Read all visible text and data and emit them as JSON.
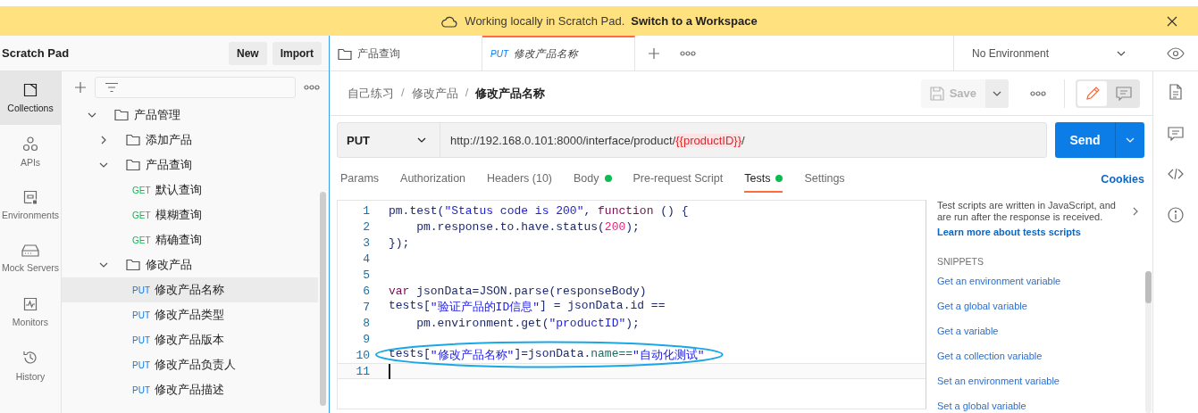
{
  "banner": {
    "text": "Working locally in Scratch Pad.",
    "link": "Switch to a Workspace"
  },
  "sidebar": {
    "title": "Scratch Pad",
    "buttons": [
      "New",
      "Import"
    ],
    "rail": [
      {
        "kind": "collections",
        "label": "Collections",
        "selected": true
      },
      {
        "kind": "apis",
        "label": "APIs",
        "selected": false
      },
      {
        "kind": "environments",
        "label": "Environments",
        "selected": false
      },
      {
        "kind": "mock",
        "label": "Mock Servers",
        "selected": false
      },
      {
        "kind": "monitors",
        "label": "Monitors",
        "selected": false
      },
      {
        "kind": "history",
        "label": "History",
        "selected": false
      }
    ],
    "tree": [
      {
        "kind": "folder",
        "name": "产品管理",
        "expanded": true,
        "children": [
          {
            "kind": "folder",
            "name": "添加产品",
            "expanded": false
          },
          {
            "kind": "folder",
            "name": "产品查询",
            "expanded": true,
            "children": [
              {
                "kind": "request",
                "method": "GET",
                "name": "默认查询",
                "selected": false
              },
              {
                "kind": "request",
                "method": "GET",
                "name": "模糊查询",
                "selected": false
              },
              {
                "kind": "request",
                "method": "GET",
                "name": "精确查询",
                "selected": false
              }
            ]
          },
          {
            "kind": "folder",
            "name": "修改产品",
            "expanded": true,
            "children": [
              {
                "kind": "request",
                "method": "PUT",
                "name": "修改产品名称",
                "selected": true
              },
              {
                "kind": "request",
                "method": "PUT",
                "name": "修改产品类型",
                "selected": false
              },
              {
                "kind": "request",
                "method": "PUT",
                "name": "修改产品版本",
                "selected": false
              },
              {
                "kind": "request",
                "method": "PUT",
                "name": "修改产品负责人",
                "selected": false
              },
              {
                "kind": "request",
                "method": "PUT",
                "name": "修改产品描述",
                "selected": false
              }
            ]
          }
        ]
      }
    ]
  },
  "tabs": [
    {
      "kind": "folder",
      "label": "产品查询",
      "preview": false,
      "selected": false
    },
    {
      "kind": "request",
      "method": "PUT",
      "label": "修改产品名称",
      "preview": true,
      "selected": true
    }
  ],
  "environment": "No Environment",
  "breadcrumb": [
    "自己练习",
    "修改产品",
    "修改产品名称"
  ],
  "breadcrumb_separator": "/",
  "save": {
    "label": "Save",
    "disabled": true
  },
  "mode_toggle": [
    {
      "kind": "edit",
      "selected": true
    },
    {
      "kind": "comment",
      "selected": false
    }
  ],
  "request": {
    "method": "PUT",
    "url": [
      {
        "kind": "text",
        "text": "http://192.168.0.101:8000/interface/product/"
      },
      {
        "kind": "variable",
        "text": "{{productID}}"
      },
      {
        "kind": "text",
        "text": "/"
      }
    ],
    "send": "Send"
  },
  "request_tabs": [
    {
      "label": "Params",
      "dot": false,
      "selected": false
    },
    {
      "label": "Authorization",
      "dot": false,
      "selected": false
    },
    {
      "label": "Headers (10)",
      "dot": false,
      "selected": false
    },
    {
      "label": "Body",
      "dot": true,
      "selected": false
    },
    {
      "label": "Pre-request Script",
      "dot": false,
      "selected": false
    },
    {
      "label": "Tests",
      "dot": true,
      "selected": true
    },
    {
      "label": "Settings",
      "dot": false,
      "selected": false
    }
  ],
  "cookies": "Cookies",
  "editor": {
    "lines": [
      {
        "number": "1",
        "tokens": [
          {
            "kind": "plain",
            "text": "pm.test("
          },
          {
            "kind": "string",
            "text": "\"Status code is 200\""
          },
          {
            "kind": "plain",
            "text": ", "
          },
          {
            "kind": "keyword",
            "text": "function"
          },
          {
            "kind": "plain",
            "text": " () {"
          }
        ],
        "circled": false,
        "active": false
      },
      {
        "number": "2",
        "tokens": [
          {
            "kind": "plain",
            "text": "    pm.response.to.have.status("
          },
          {
            "kind": "number",
            "text": "200"
          },
          {
            "kind": "plain",
            "text": ");"
          }
        ],
        "circled": false,
        "active": false
      },
      {
        "number": "3",
        "tokens": [
          {
            "kind": "plain",
            "text": "});"
          }
        ],
        "circled": false,
        "active": false
      },
      {
        "number": "4",
        "circled": false,
        "active": false
      },
      {
        "number": "5",
        "circled": false,
        "active": false
      },
      {
        "number": "6",
        "tokens": [
          {
            "kind": "keyword",
            "text": "var"
          },
          {
            "kind": "plain",
            "text": " jsonData=JSON.parse(responseBody)"
          }
        ],
        "circled": false,
        "active": false
      },
      {
        "number": "7",
        "tokens": [
          {
            "kind": "plain",
            "text": "tests["
          },
          {
            "kind": "string",
            "text": "\"验证产品的ID信息\""
          },
          {
            "kind": "plain",
            "text": "] = jsonData.id =="
          }
        ],
        "circled": false,
        "active": false
      },
      {
        "number": "8",
        "tokens": [
          {
            "kind": "plain",
            "text": "    pm.environment.get("
          },
          {
            "kind": "string",
            "text": "\"productID\""
          },
          {
            "kind": "plain",
            "text": ");"
          }
        ],
        "circled": false,
        "active": false
      },
      {
        "number": "9",
        "circled": false,
        "active": false
      },
      {
        "number": "10",
        "tokens": [
          {
            "kind": "plain",
            "text": "tests["
          },
          {
            "kind": "string",
            "text": "\"修改产品名称\""
          },
          {
            "kind": "plain",
            "text": "]=jsonData."
          },
          {
            "kind": "property",
            "text": "name=="
          },
          {
            "kind": "string",
            "text": "\"自动化测试\""
          }
        ],
        "circled": true,
        "active": false
      },
      {
        "number": "11",
        "circled": false,
        "active": true
      }
    ]
  },
  "snippets": {
    "intro": "Test scripts are written in JavaScript, and are run after the response is received.",
    "link": "Learn more about tests scripts",
    "heading": "SNIPPETS",
    "items": [
      "Get an environment variable",
      "Get a global variable",
      "Get a variable",
      "Get a collection variable",
      "Set an environment variable",
      "Set a global variable"
    ]
  }
}
